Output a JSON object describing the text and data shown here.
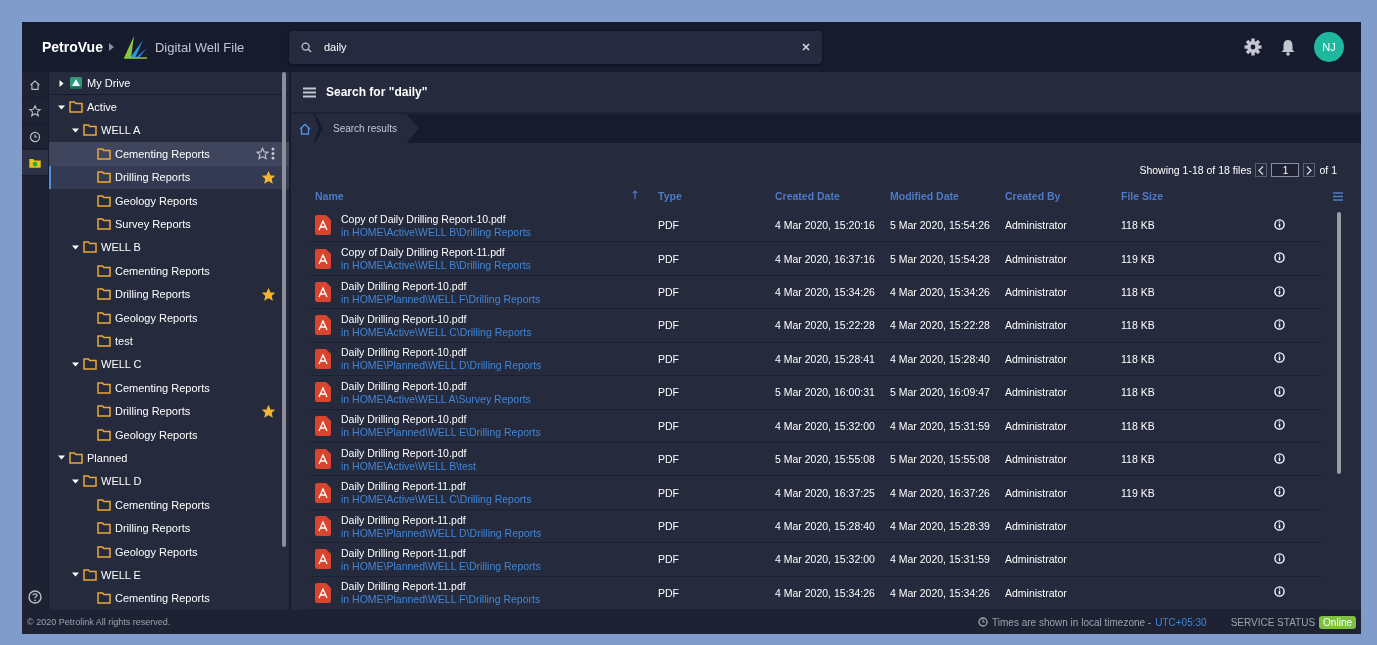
{
  "header": {
    "product": "PetroVue",
    "app_name": "Digital Well File",
    "search": {
      "value": "daily"
    },
    "avatar": "NJ"
  },
  "rail": [
    {
      "kind": "home",
      "selected": false
    },
    {
      "kind": "star",
      "selected": false
    },
    {
      "kind": "recent",
      "selected": false
    },
    {
      "kind": "folder",
      "selected": true
    }
  ],
  "tree": [
    {
      "label": "My Drive",
      "kind": "drive",
      "expanded": false,
      "selected": false
    },
    {
      "label": "Active",
      "kind": "folder",
      "expanded": true,
      "selected": false,
      "children": [
        {
          "label": "WELL A",
          "kind": "folder",
          "expanded": true,
          "selected": false,
          "children": [
            {
              "label": "Cementing Reports",
              "kind": "folder",
              "selected": false,
              "hovered": true,
              "starred": false
            },
            {
              "label": "Drilling Reports",
              "kind": "folder",
              "selected": true,
              "starred": true
            },
            {
              "label": "Geology Reports",
              "kind": "folder",
              "selected": false,
              "starred": false
            },
            {
              "label": "Survey Reports",
              "kind": "folder",
              "selected": false,
              "starred": false
            }
          ]
        },
        {
          "label": "WELL B",
          "kind": "folder",
          "expanded": true,
          "selected": false,
          "children": [
            {
              "label": "Cementing Reports",
              "kind": "folder",
              "selected": false,
              "starred": false
            },
            {
              "label": "Drilling Reports",
              "kind": "folder",
              "selected": false,
              "starred": true
            },
            {
              "label": "Geology Reports",
              "kind": "folder",
              "selected": false,
              "starred": false
            },
            {
              "label": "test",
              "kind": "folder",
              "selected": false,
              "starred": false
            }
          ]
        },
        {
          "label": "WELL C",
          "kind": "folder",
          "expanded": true,
          "selected": false,
          "children": [
            {
              "label": "Cementing Reports",
              "kind": "folder",
              "selected": false,
              "starred": false
            },
            {
              "label": "Drilling Reports",
              "kind": "folder",
              "selected": false,
              "starred": true
            },
            {
              "label": "Geology Reports",
              "kind": "folder",
              "selected": false,
              "starred": false
            }
          ]
        }
      ]
    },
    {
      "label": "Planned",
      "kind": "folder",
      "expanded": true,
      "selected": false,
      "children": [
        {
          "label": "WELL D",
          "kind": "folder",
          "expanded": true,
          "selected": false,
          "children": [
            {
              "label": "Cementing Reports",
              "kind": "folder",
              "selected": false,
              "starred": false
            },
            {
              "label": "Drilling Reports",
              "kind": "folder",
              "selected": false,
              "starred": false
            },
            {
              "label": "Geology Reports",
              "kind": "folder",
              "selected": false,
              "starred": false
            }
          ]
        },
        {
          "label": "WELL E",
          "kind": "folder",
          "expanded": true,
          "selected": false,
          "children": [
            {
              "label": "Cementing Reports",
              "kind": "folder",
              "selected": false,
              "starred": false
            }
          ]
        }
      ]
    }
  ],
  "main": {
    "title": "Search for \"daily\"",
    "breadcrumb": [
      "Search results"
    ],
    "pagination": {
      "summary": "Showing 1-18 of 18 files",
      "page": "1",
      "total": "of 1"
    },
    "table": {
      "columns": [
        "Name",
        "Type",
        "Created Date",
        "Modified Date",
        "Created By",
        "File Size"
      ],
      "rows": [
        {
          "name": "Copy of Daily Drilling Report-10.pdf",
          "location": "in HOME\\Active\\WELL B\\Drilling Reports",
          "type": "PDF",
          "created": "4 Mar 2020, 15:20:16",
          "modified": "5 Mar 2020, 15:54:26",
          "created_by": "Administrator",
          "size": "118 KB"
        },
        {
          "name": "Copy of Daily Drilling Report-11.pdf",
          "location": "in HOME\\Active\\WELL B\\Drilling Reports",
          "type": "PDF",
          "created": "4 Mar 2020, 16:37:16",
          "modified": "5 Mar 2020, 15:54:28",
          "created_by": "Administrator",
          "size": "119 KB"
        },
        {
          "name": "Daily Drilling Report-10.pdf",
          "location": "in HOME\\Planned\\WELL F\\Drilling Reports",
          "type": "PDF",
          "created": "4 Mar 2020, 15:34:26",
          "modified": "4 Mar 2020, 15:34:26",
          "created_by": "Administrator",
          "size": "118 KB"
        },
        {
          "name": "Daily Drilling Report-10.pdf",
          "location": "in HOME\\Active\\WELL C\\Drilling Reports",
          "type": "PDF",
          "created": "4 Mar 2020, 15:22:28",
          "modified": "4 Mar 2020, 15:22:28",
          "created_by": "Administrator",
          "size": "118 KB"
        },
        {
          "name": "Daily Drilling Report-10.pdf",
          "location": "in HOME\\Planned\\WELL D\\Drilling Reports",
          "type": "PDF",
          "created": "4 Mar 2020, 15:28:41",
          "modified": "4 Mar 2020, 15:28:40",
          "created_by": "Administrator",
          "size": "118 KB"
        },
        {
          "name": "Daily Drilling Report-10.pdf",
          "location": "in HOME\\Active\\WELL A\\Survey Reports",
          "type": "PDF",
          "created": "5 Mar 2020, 16:00:31",
          "modified": "5 Mar 2020, 16:09:47",
          "created_by": "Administrator",
          "size": "118 KB"
        },
        {
          "name": "Daily Drilling Report-10.pdf",
          "location": "in HOME\\Planned\\WELL E\\Drilling Reports",
          "type": "PDF",
          "created": "4 Mar 2020, 15:32:00",
          "modified": "4 Mar 2020, 15:31:59",
          "created_by": "Administrator",
          "size": "118 KB"
        },
        {
          "name": "Daily Drilling Report-10.pdf",
          "location": "in HOME\\Active\\WELL B\\test",
          "type": "PDF",
          "created": "5 Mar 2020, 15:55:08",
          "modified": "5 Mar 2020, 15:55:08",
          "created_by": "Administrator",
          "size": "118 KB"
        },
        {
          "name": "Daily Drilling Report-11.pdf",
          "location": "in HOME\\Active\\WELL C\\Drilling Reports",
          "type": "PDF",
          "created": "4 Mar 2020, 16:37:25",
          "modified": "4 Mar 2020, 16:37:26",
          "created_by": "Administrator",
          "size": "119 KB"
        },
        {
          "name": "Daily Drilling Report-11.pdf",
          "location": "in HOME\\Planned\\WELL D\\Drilling Reports",
          "type": "PDF",
          "created": "4 Mar 2020, 15:28:40",
          "modified": "4 Mar 2020, 15:28:39",
          "created_by": "Administrator"
        },
        {
          "name": "Daily Drilling Report-11.pdf",
          "location": "in HOME\\Planned\\WELL E\\Drilling Reports",
          "type": "PDF",
          "created": "4 Mar 2020, 15:32:00",
          "modified": "4 Mar 2020, 15:31:59",
          "created_by": "Administrator"
        },
        {
          "name": "Daily Drilling Report-11.pdf",
          "location": "in HOME\\Planned\\WELL F\\Drilling Reports",
          "type": "PDF",
          "created": "4 Mar 2020, 15:34:26",
          "modified": "4 Mar 2020, 15:34:26",
          "created_by": "Administrator"
        }
      ]
    }
  },
  "footer": {
    "copyright": "© 2020 Petrolink All rights reserved.",
    "timezone_note": "Times are shown in local timezone -",
    "timezone": "UTC+05:30",
    "service_label": "SERVICE STATUS",
    "service_status": "Online"
  }
}
